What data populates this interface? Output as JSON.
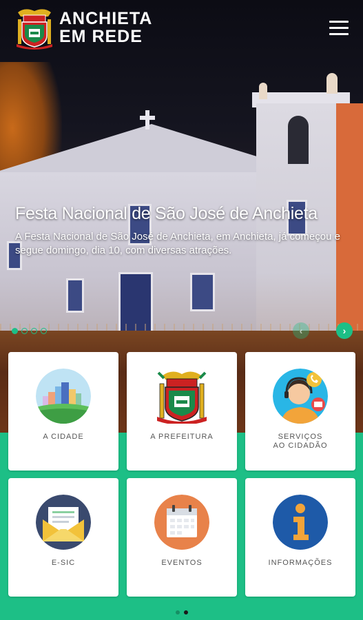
{
  "header": {
    "brand_line1": "ANCHIETA",
    "brand_line2": "EM REDE",
    "logo_icon": "coat-of-arms-icon",
    "menu_icon": "hamburger-menu-icon"
  },
  "slider": {
    "title": "Festa Nacional de São José de Anchieta",
    "description": "A Festa Nacional de São José de Anchieta, em Anchieta, já começou e segue domingo, dia 10, com diversas atrações.",
    "slide_count": 4,
    "active_slide": 1,
    "prev_icon": "chevron-left-icon",
    "next_icon": "chevron-right-icon",
    "prev_glyph": "‹",
    "next_glyph": "›"
  },
  "tiles": [
    {
      "label": "A CIDADE",
      "icon": "city-icon"
    },
    {
      "label": "A PREFEITURA",
      "icon": "coat-of-arms-icon"
    },
    {
      "label": "SERVIÇOS\nAO CIDADÃO",
      "icon": "support-agent-icon"
    },
    {
      "label": "E-SIC",
      "icon": "envelope-icon"
    },
    {
      "label": "EVENTOS",
      "icon": "calendar-icon"
    },
    {
      "label": "INFORMAÇÕES",
      "icon": "info-icon"
    }
  ],
  "pagination": {
    "pages": 2,
    "active_page": 2
  },
  "colors": {
    "accent": "#1dbf86",
    "card_bg": "#ffffff",
    "label_text": "#555555"
  }
}
